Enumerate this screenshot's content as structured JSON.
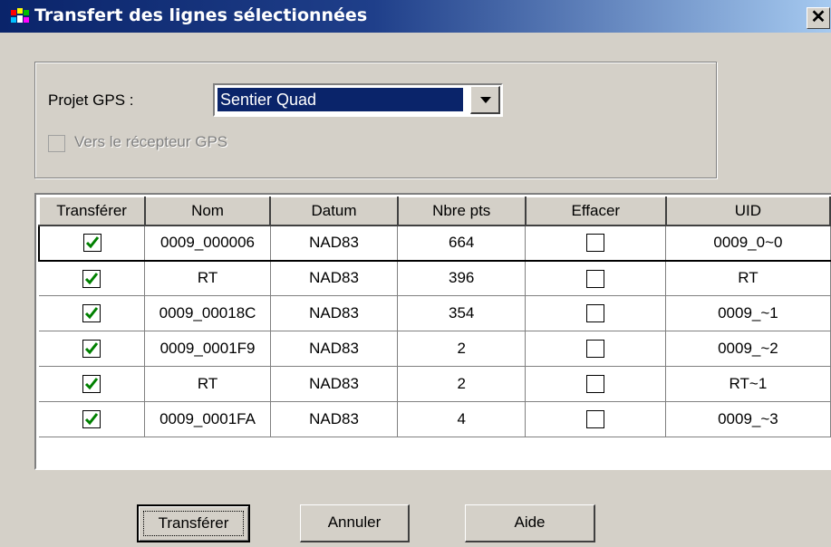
{
  "window": {
    "title": "Transfert des lignes sélectionnées",
    "close_label": "✕"
  },
  "projet": {
    "label": "Projet GPS :",
    "value": "Sentier Quad"
  },
  "receiver": {
    "label": "Vers le récepteur GPS",
    "checked": false,
    "enabled": false
  },
  "grid": {
    "columns": [
      "Transférer",
      "Nom",
      "Datum",
      "Nbre pts",
      "Effacer",
      "UID"
    ],
    "rows": [
      {
        "transferer": true,
        "nom": "0009_000006",
        "datum": "NAD83",
        "nbre": "664",
        "effacer": false,
        "uid": "0009_0~0"
      },
      {
        "transferer": true,
        "nom": "RT",
        "datum": "NAD83",
        "nbre": "396",
        "effacer": false,
        "uid": "RT"
      },
      {
        "transferer": true,
        "nom": "0009_00018C",
        "datum": "NAD83",
        "nbre": "354",
        "effacer": false,
        "uid": "0009_~1"
      },
      {
        "transferer": true,
        "nom": "0009_0001F9",
        "datum": "NAD83",
        "nbre": "2",
        "effacer": false,
        "uid": "0009_~2"
      },
      {
        "transferer": true,
        "nom": "RT",
        "datum": "NAD83",
        "nbre": "2",
        "effacer": false,
        "uid": "RT~1"
      },
      {
        "transferer": true,
        "nom": "0009_0001FA",
        "datum": "NAD83",
        "nbre": "4",
        "effacer": false,
        "uid": "0009_~3"
      }
    ]
  },
  "buttons": {
    "transferer": "Transférer",
    "annuler": "Annuler",
    "aide": "Aide"
  },
  "colors": {
    "titlebar": "#0a246a",
    "check": "#008000",
    "face": "#d4d0c8"
  }
}
